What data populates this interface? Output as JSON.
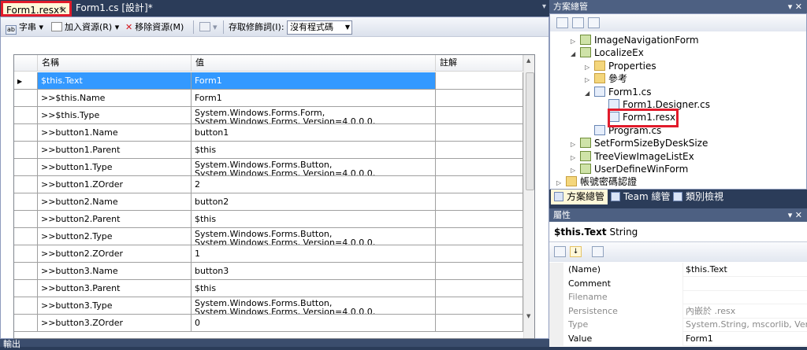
{
  "doc_tabs": [
    {
      "label": "Form1.resx*",
      "close": "✕"
    },
    {
      "label": "Form1.cs [設計]*"
    }
  ],
  "toolbar": {
    "strings_label": "字串",
    "add_resource_label": "加入資源(R)",
    "remove_resource_label": "移除資源(M)",
    "access_modifier_label": "存取修飾詞(I):",
    "access_modifier_value": "沒有程式碼"
  },
  "grid": {
    "columns": [
      "名稱",
      "值",
      "註解"
    ],
    "rows": [
      {
        "name": "$this.Text",
        "value": "Form1",
        "comment": "",
        "selected": true
      },
      {
        "name": ">>$this.Name",
        "value": "Form1",
        "comment": ""
      },
      {
        "name": ">>$this.Type",
        "value": "System.Windows.Forms.Form, System.Windows.Forms, Version=4.0.0.0, Culture=neutral",
        "comment": ""
      },
      {
        "name": ">>button1.Name",
        "value": "button1",
        "comment": ""
      },
      {
        "name": ">>button1.Parent",
        "value": "$this",
        "comment": ""
      },
      {
        "name": ">>button1.Type",
        "value": "System.Windows.Forms.Button, System.Windows.Forms, Version=4.0.0.0, Culture=neutral",
        "comment": ""
      },
      {
        "name": ">>button1.ZOrder",
        "value": "2",
        "comment": ""
      },
      {
        "name": ">>button2.Name",
        "value": "button2",
        "comment": ""
      },
      {
        "name": ">>button2.Parent",
        "value": "$this",
        "comment": ""
      },
      {
        "name": ">>button2.Type",
        "value": "System.Windows.Forms.Button, System.Windows.Forms, Version=4.0.0.0, Culture=neutral",
        "comment": ""
      },
      {
        "name": ">>button2.ZOrder",
        "value": "1",
        "comment": ""
      },
      {
        "name": ">>button3.Name",
        "value": "button3",
        "comment": ""
      },
      {
        "name": ">>button3.Parent",
        "value": "$this",
        "comment": ""
      },
      {
        "name": ">>button3.Type",
        "value": "System.Windows.Forms.Button, System.Windows.Forms, Version=4.0.0.0, Culture=neutral",
        "comment": ""
      },
      {
        "name": ">>button3.ZOrder",
        "value": "0",
        "comment": ""
      }
    ]
  },
  "output_label": "輸出",
  "solution": {
    "title": "方案總管",
    "pin": "▾ ✕",
    "items": [
      {
        "label": "ImageNavigationForm",
        "indent": 1,
        "expander": "▷",
        "icon": "csharp-project-icon"
      },
      {
        "label": "LocalizeEx",
        "indent": 1,
        "expander": "◢",
        "icon": "csharp-project-icon"
      },
      {
        "label": "Properties",
        "indent": 2,
        "expander": "▷",
        "icon": "properties-folder-icon"
      },
      {
        "label": "參考",
        "indent": 2,
        "expander": "▷",
        "icon": "references-icon"
      },
      {
        "label": "Form1.cs",
        "indent": 2,
        "expander": "◢",
        "icon": "form-file-icon"
      },
      {
        "label": "Form1.Designer.cs",
        "indent": 3,
        "expander": "",
        "icon": "cs-file-icon"
      },
      {
        "label": "Form1.resx",
        "indent": 3,
        "expander": "",
        "icon": "resx-file-icon",
        "highlighted": true
      },
      {
        "label": "Program.cs",
        "indent": 2,
        "expander": "",
        "icon": "cs-file-icon"
      },
      {
        "label": "SetFormSizeByDeskSize",
        "indent": 1,
        "expander": "▷",
        "icon": "csharp-project-icon"
      },
      {
        "label": "TreeViewImageListEx",
        "indent": 1,
        "expander": "▷",
        "icon": "csharp-project-icon"
      },
      {
        "label": "UserDefineWinForm",
        "indent": 1,
        "expander": "▷",
        "icon": "csharp-project-icon"
      },
      {
        "label": "帳號密碼認證",
        "indent": 0,
        "expander": "▷",
        "icon": "folder-icon"
      }
    ],
    "tabs": [
      "方案總管",
      "Team 總管",
      "類別檢視"
    ]
  },
  "properties": {
    "title": "屬性",
    "pin": "▾ ✕",
    "selected_name": "$this.Text",
    "selected_type": "String",
    "rows": [
      {
        "name": "(Name)",
        "value": "$this.Text",
        "disabled": false
      },
      {
        "name": "Comment",
        "value": "",
        "disabled": false
      },
      {
        "name": "Filename",
        "value": "",
        "disabled": true
      },
      {
        "name": "Persistence",
        "value": "內嵌於 .resx",
        "disabled": true
      },
      {
        "name": "Type",
        "value": "System.String, mscorlib, Version",
        "disabled": true
      },
      {
        "name": "Value",
        "value": "Form1",
        "disabled": false
      }
    ]
  }
}
